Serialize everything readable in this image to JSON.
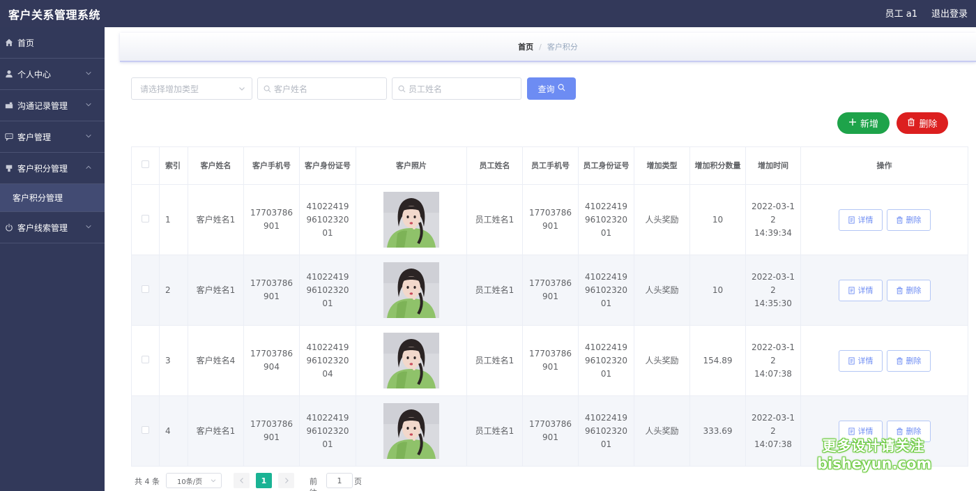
{
  "header": {
    "title": "客户关系管理系统",
    "user": "员工 a1",
    "logout": "退出登录"
  },
  "sidebar": {
    "items": [
      {
        "label": "首页",
        "icon": "home-icon"
      },
      {
        "label": "个人中心",
        "icon": "user-icon"
      },
      {
        "label": "沟通记录管理",
        "icon": "briefcase-icon"
      },
      {
        "label": "客户管理",
        "icon": "chat-icon"
      },
      {
        "label": "客户积分管理",
        "icon": "flag-icon"
      },
      {
        "label": "客户线索管理",
        "icon": "power-icon"
      }
    ],
    "active_submenu": "客户积分管理"
  },
  "breadcrumb": {
    "home": "首页",
    "separator": "/",
    "current": "客户积分"
  },
  "filters": {
    "type_placeholder": "请选择增加类型",
    "customer_placeholder": "客户姓名",
    "employee_placeholder": "员工姓名",
    "query_label": "查询"
  },
  "actions": {
    "add_label": "新增",
    "delete_label": "删除"
  },
  "table": {
    "columns": [
      "索引",
      "客户姓名",
      "客户手机号",
      "客户身份证号",
      "客户照片",
      "员工姓名",
      "员工手机号",
      "员工身份证号",
      "增加类型",
      "增加积分数量",
      "增加时间",
      "操作"
    ],
    "rows": [
      {
        "index": "1",
        "customer_name": "客户姓名1",
        "customer_phone": "17703786901",
        "customer_id": "410224199610232001",
        "employee_name": "员工姓名1",
        "employee_phone": "17703786901",
        "employee_id": "410224199610232001",
        "type": "人头奖励",
        "points": "10",
        "date": "2022-03-12",
        "time": "14:39:34"
      },
      {
        "index": "2",
        "customer_name": "客户姓名1",
        "customer_phone": "17703786901",
        "customer_id": "410224199610232001",
        "employee_name": "员工姓名1",
        "employee_phone": "17703786901",
        "employee_id": "410224199610232001",
        "type": "人头奖励",
        "points": "10",
        "date": "2022-03-12",
        "time": "14:35:30"
      },
      {
        "index": "3",
        "customer_name": "客户姓名4",
        "customer_phone": "17703786904",
        "customer_id": "410224199610232004",
        "employee_name": "员工姓名1",
        "employee_phone": "17703786901",
        "employee_id": "410224199610232001",
        "type": "人头奖励",
        "points": "154.89",
        "date": "2022-03-12",
        "time": "14:07:38"
      },
      {
        "index": "4",
        "customer_name": "客户姓名1",
        "customer_phone": "17703786901",
        "customer_id": "410224199610232001",
        "employee_name": "员工姓名1",
        "employee_phone": "17703786901",
        "employee_id": "410224199610232001",
        "type": "人头奖励",
        "points": "333.69",
        "date": "2022-03-12",
        "time": "14:07:38"
      }
    ],
    "detail_label": "详情",
    "delete_label": "删除"
  },
  "pagination": {
    "total": "共 4 条",
    "page_size": "10条/页",
    "current_page": "1",
    "goto_label": "前往",
    "goto_value": "1",
    "page_unit": "页"
  },
  "watermark": {
    "line1": "更多设计请关注",
    "line2": "bisheyun.com"
  },
  "colors": {
    "topbar": "#33395a",
    "sidebar": "#32395a",
    "primary": "#6d8cf3",
    "success": "#1ea34a",
    "danger": "#dc1f1f",
    "pager_active": "#1ab394"
  }
}
